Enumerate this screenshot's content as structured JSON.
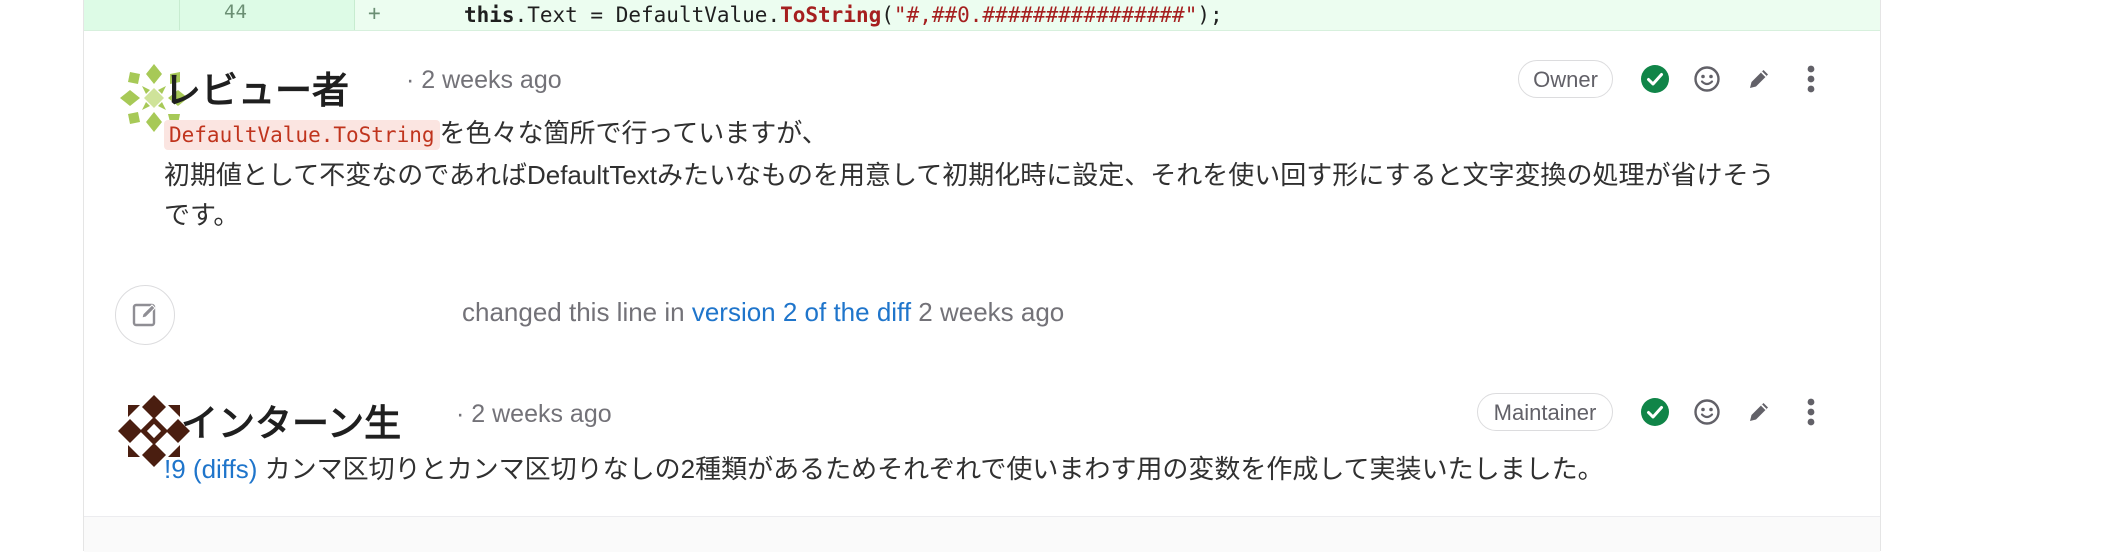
{
  "diff": {
    "line_number": "44",
    "marker": "+",
    "code_this": "this",
    "code_mid": ".Text = DefaultValue.",
    "code_fn": "ToString",
    "code_open": "(",
    "code_str": "\"#,##0.################\"",
    "code_close": ");"
  },
  "notes": [
    {
      "author": "レビュー者",
      "meta": "· 2 weeks ago",
      "role": "Owner",
      "code": "DefaultValue.ToString",
      "line1_rest": "を色々な箇所で行っていますが、",
      "line2": "初期値として不変なのであればDefaultTextみたいなものを用意して初期化時に設定、それを使い回す形にすると文字変換の処理が省けそう",
      "line3": "です。"
    },
    {
      "author": "インターン生",
      "meta": "· 2 weeks ago",
      "role": "Maintainer",
      "link": "!9 (diffs)",
      "text": " カンマ区切りとカンマ区切りなしの2種類があるためそれぞれで使いまわす用の変数を作成して実装いたしました。"
    }
  ],
  "system_note": {
    "prefix": "changed this line in ",
    "link": "version 2 of the diff",
    "suffix": " 2 weeks ago"
  },
  "colors": {
    "resolved_green": "#108548",
    "link_blue": "#1f75cb",
    "avatar1": "#a7c957",
    "avatar2": "#4a1e10"
  },
  "icons": [
    "resolved-check-icon",
    "emoji-icon",
    "pencil-icon",
    "kebab-menu-icon",
    "edit-note-icon"
  ]
}
